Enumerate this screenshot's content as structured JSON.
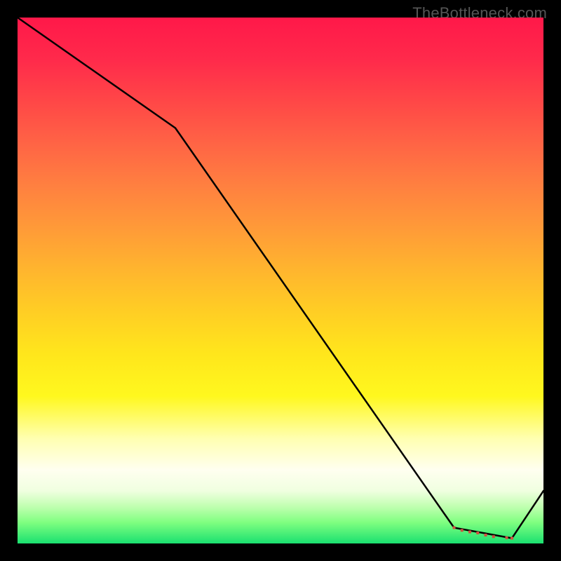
{
  "watermark": "TheBottleneck.com",
  "chart_data": {
    "type": "line",
    "title": "",
    "xlabel": "",
    "ylabel": "",
    "xlim": [
      0,
      100
    ],
    "ylim": [
      0,
      100
    ],
    "background_gradient": {
      "top": "#ff1849",
      "middle": "#ffe61c",
      "bottom": "#1ae070"
    },
    "series": [
      {
        "name": "curve",
        "x": [
          0,
          30,
          83,
          94,
          100
        ],
        "y": [
          100,
          79,
          3,
          1,
          10
        ]
      }
    ],
    "markers": {
      "shape": "square",
      "color": "#d05040",
      "x": [
        83,
        84.5,
        86,
        87.5,
        89,
        90.5,
        93,
        94
      ],
      "y": [
        3.0,
        2.5,
        2.2,
        2.0,
        1.6,
        1.3,
        1.1,
        1.0
      ]
    }
  }
}
